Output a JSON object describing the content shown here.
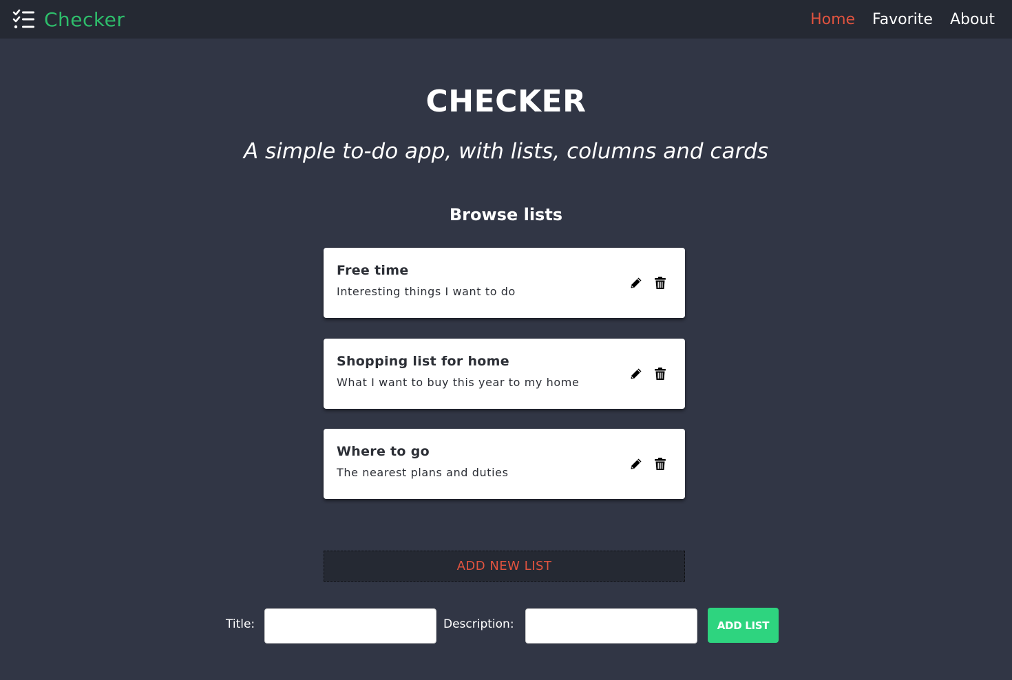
{
  "navbar": {
    "brand_icon": "checklist-icon",
    "brand_text": "Checker",
    "brand_color": "#2ebd6b",
    "links": [
      {
        "label": "Home",
        "active": true
      },
      {
        "label": "Favorite",
        "active": false
      },
      {
        "label": "About",
        "active": false
      }
    ],
    "active_color": "#e0533f"
  },
  "hero": {
    "title": "CHECKER",
    "subtitle": "A simple to-do app, with lists, columns and cards"
  },
  "browse": {
    "heading": "Browse lists",
    "lists": [
      {
        "title": "Free time",
        "description": "Interesting things I want to do",
        "edit_icon": "pencil-icon",
        "delete_icon": "trash-icon"
      },
      {
        "title": "Shopping list for home",
        "description": "What I want to buy this year to my home",
        "edit_icon": "pencil-icon",
        "delete_icon": "trash-icon"
      },
      {
        "title": "Where to go",
        "description": "The nearest plans and duties",
        "edit_icon": "pencil-icon",
        "delete_icon": "trash-icon"
      }
    ]
  },
  "add_new_list": {
    "label": "ADD NEW LIST"
  },
  "form": {
    "title_label": "Title:",
    "title_value": "",
    "description_label": "Description:",
    "description_value": "",
    "submit_label": "ADD LIST",
    "submit_color": "#2ed47f"
  },
  "colors": {
    "background": "#313645",
    "navbar": "#252933",
    "accent_red": "#e0533f",
    "accent_green": "#2ebd6b"
  }
}
